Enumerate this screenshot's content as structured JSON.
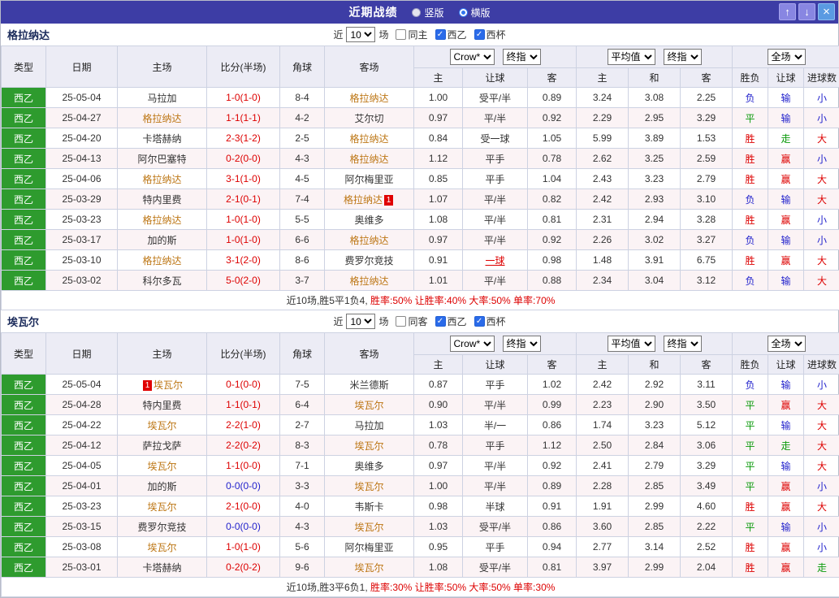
{
  "titlebar": {
    "title": "近期战绩",
    "radio_vertical": "竖版",
    "radio_horizontal": "横版"
  },
  "icons": {
    "up": "↑",
    "down": "↓",
    "close": "×"
  },
  "labels": {
    "near": "近",
    "games": "场"
  },
  "table_head": {
    "type": "类型",
    "date": "日期",
    "home": "主场",
    "score": "比分(半场)",
    "corner": "角球",
    "away": "客场",
    "company": "Crow*",
    "stage": "终指",
    "avg": "平均值",
    "stage2": "终指",
    "scope": "全场",
    "sub": [
      "主",
      "让球",
      "客",
      "主",
      "和",
      "客",
      "胜负",
      "让球",
      "进球数"
    ]
  },
  "colors": {
    "header_bg": "#3d3da5",
    "type_green": "#2e9b2e",
    "team_highlight": "#bd7614",
    "score_red": "#dd0000",
    "score_blue": "#2222cc",
    "result_map": {
      "胜": "#dd0000",
      "平": "#0b9a0b",
      "负": "#2222cc",
      "赢": "#dd0000",
      "走": "#0b9a0b",
      "输": "#2222cc",
      "大": "#dd0000",
      "小": "#2222cc"
    }
  },
  "sections": [
    {
      "team": "格拉纳达",
      "filter": {
        "count": "10",
        "same": "同主",
        "same_checked": false,
        "league": "西乙",
        "league_checked": true,
        "cup": "西杯",
        "cup_checked": true
      },
      "rows": [
        {
          "type": "西乙",
          "date": "25-05-04",
          "home": "马拉加",
          "home_hl": false,
          "score": "1-0(1-0)",
          "corner": "8-4",
          "away": "格拉纳达",
          "away_hl": true,
          "odds_h": "1.00",
          "line": "受平/半",
          "odds_a": "0.89",
          "avg_h": "3.24",
          "avg_d": "3.08",
          "avg_a": "2.25",
          "res": "负",
          "cover": "输",
          "goals": "小"
        },
        {
          "type": "西乙",
          "date": "25-04-27",
          "home": "格拉纳达",
          "home_hl": true,
          "score": "1-1(1-1)",
          "corner": "4-2",
          "away": "艾尔切",
          "away_hl": false,
          "odds_h": "0.97",
          "line": "平/半",
          "odds_a": "0.92",
          "avg_h": "2.29",
          "avg_d": "2.95",
          "avg_a": "3.29",
          "res": "平",
          "cover": "输",
          "goals": "小"
        },
        {
          "type": "西乙",
          "date": "25-04-20",
          "home": "卡塔赫纳",
          "home_hl": false,
          "score": "2-3(1-2)",
          "corner": "2-5",
          "away": "格拉纳达",
          "away_hl": true,
          "odds_h": "0.84",
          "line": "受一球",
          "odds_a": "1.05",
          "avg_h": "5.99",
          "avg_d": "3.89",
          "avg_a": "1.53",
          "res": "胜",
          "cover": "走",
          "goals": "大"
        },
        {
          "type": "西乙",
          "date": "25-04-13",
          "home": "阿尔巴塞特",
          "home_hl": false,
          "score": "0-2(0-0)",
          "corner": "4-3",
          "away": "格拉纳达",
          "away_hl": true,
          "odds_h": "1.12",
          "line": "平手",
          "odds_a": "0.78",
          "avg_h": "2.62",
          "avg_d": "3.25",
          "avg_a": "2.59",
          "res": "胜",
          "cover": "赢",
          "goals": "小"
        },
        {
          "type": "西乙",
          "date": "25-04-06",
          "home": "格拉纳达",
          "home_hl": true,
          "score": "3-1(1-0)",
          "corner": "4-5",
          "away": "阿尔梅里亚",
          "away_hl": false,
          "odds_h": "0.85",
          "line": "平手",
          "odds_a": "1.04",
          "avg_h": "2.43",
          "avg_d": "3.23",
          "avg_a": "2.79",
          "res": "胜",
          "cover": "赢",
          "goals": "大"
        },
        {
          "type": "西乙",
          "date": "25-03-29",
          "home": "特内里费",
          "home_hl": false,
          "score": "2-1(0-1)",
          "corner": "7-4",
          "away": "格拉纳达",
          "away_hl": true,
          "away_badge": "1",
          "away_badge_pos": "after",
          "odds_h": "1.07",
          "line": "平/半",
          "odds_a": "0.82",
          "avg_h": "2.42",
          "avg_d": "2.93",
          "avg_a": "3.10",
          "res": "负",
          "cover": "输",
          "goals": "大"
        },
        {
          "type": "西乙",
          "date": "25-03-23",
          "home": "格拉纳达",
          "home_hl": true,
          "score": "1-0(1-0)",
          "corner": "5-5",
          "away": "奥维多",
          "away_hl": false,
          "odds_h": "1.08",
          "line": "平/半",
          "odds_a": "0.81",
          "avg_h": "2.31",
          "avg_d": "2.94",
          "avg_a": "3.28",
          "res": "胜",
          "cover": "赢",
          "goals": "小"
        },
        {
          "type": "西乙",
          "date": "25-03-17",
          "home": "加的斯",
          "home_hl": false,
          "score": "1-0(1-0)",
          "corner": "6-6",
          "away": "格拉纳达",
          "away_hl": true,
          "odds_h": "0.97",
          "line": "平/半",
          "odds_a": "0.92",
          "avg_h": "2.26",
          "avg_d": "3.02",
          "avg_a": "3.27",
          "res": "负",
          "cover": "输",
          "goals": "小"
        },
        {
          "type": "西乙",
          "date": "25-03-10",
          "home": "格拉纳达",
          "home_hl": true,
          "score": "3-1(2-0)",
          "corner": "8-6",
          "away": "费罗尔竞技",
          "away_hl": false,
          "odds_h": "0.91",
          "line": "一球",
          "line_hl": true,
          "odds_a": "0.98",
          "avg_h": "1.48",
          "avg_d": "3.91",
          "avg_a": "6.75",
          "res": "胜",
          "cover": "赢",
          "goals": "大"
        },
        {
          "type": "西乙",
          "date": "25-03-02",
          "home": "科尔多瓦",
          "home_hl": false,
          "score": "5-0(2-0)",
          "corner": "3-7",
          "away": "格拉纳达",
          "away_hl": true,
          "odds_h": "1.01",
          "line": "平/半",
          "odds_a": "0.88",
          "avg_h": "2.34",
          "avg_d": "3.04",
          "avg_a": "3.12",
          "res": "负",
          "cover": "输",
          "goals": "大"
        }
      ],
      "summary_prefix": "近10场,胜5平1负4,",
      "summary_stats": "胜率:50% 让胜率:40% 大率:50% 单率:70%"
    },
    {
      "team": "埃瓦尔",
      "filter": {
        "count": "10",
        "same": "同客",
        "same_checked": false,
        "league": "西乙",
        "league_checked": true,
        "cup": "西杯",
        "cup_checked": true
      },
      "rows": [
        {
          "type": "西乙",
          "date": "25-05-04",
          "home": "埃瓦尔",
          "home_hl": true,
          "home_badge": "1",
          "home_badge_pos": "before",
          "score": "0-1(0-0)",
          "corner": "7-5",
          "away": "米兰德斯",
          "away_hl": false,
          "odds_h": "0.87",
          "line": "平手",
          "odds_a": "1.02",
          "avg_h": "2.42",
          "avg_d": "2.92",
          "avg_a": "3.11",
          "res": "负",
          "cover": "输",
          "goals": "小"
        },
        {
          "type": "西乙",
          "date": "25-04-28",
          "home": "特内里费",
          "home_hl": false,
          "score": "1-1(0-1)",
          "corner": "6-4",
          "away": "埃瓦尔",
          "away_hl": true,
          "odds_h": "0.90",
          "line": "平/半",
          "odds_a": "0.99",
          "avg_h": "2.23",
          "avg_d": "2.90",
          "avg_a": "3.50",
          "res": "平",
          "cover": "赢",
          "goals": "大"
        },
        {
          "type": "西乙",
          "date": "25-04-22",
          "home": "埃瓦尔",
          "home_hl": true,
          "score": "2-2(1-0)",
          "corner": "2-7",
          "away": "马拉加",
          "away_hl": false,
          "odds_h": "1.03",
          "line": "半/一",
          "odds_a": "0.86",
          "avg_h": "1.74",
          "avg_d": "3.23",
          "avg_a": "5.12",
          "res": "平",
          "cover": "输",
          "goals": "大"
        },
        {
          "type": "西乙",
          "date": "25-04-12",
          "home": "萨拉戈萨",
          "home_hl": false,
          "score": "2-2(0-2)",
          "corner": "8-3",
          "away": "埃瓦尔",
          "away_hl": true,
          "odds_h": "0.78",
          "line": "平手",
          "odds_a": "1.12",
          "avg_h": "2.50",
          "avg_d": "2.84",
          "avg_a": "3.06",
          "res": "平",
          "cover": "走",
          "goals": "大"
        },
        {
          "type": "西乙",
          "date": "25-04-05",
          "home": "埃瓦尔",
          "home_hl": true,
          "score": "1-1(0-0)",
          "corner": "7-1",
          "away": "奥维多",
          "away_hl": false,
          "odds_h": "0.97",
          "line": "平/半",
          "odds_a": "0.92",
          "avg_h": "2.41",
          "avg_d": "2.79",
          "avg_a": "3.29",
          "res": "平",
          "cover": "输",
          "goals": "大"
        },
        {
          "type": "西乙",
          "date": "25-04-01",
          "home": "加的斯",
          "home_hl": false,
          "score": "0-0(0-0)",
          "score_blue": true,
          "corner": "3-3",
          "away": "埃瓦尔",
          "away_hl": true,
          "odds_h": "1.00",
          "line": "平/半",
          "odds_a": "0.89",
          "avg_h": "2.28",
          "avg_d": "2.85",
          "avg_a": "3.49",
          "res": "平",
          "cover": "赢",
          "goals": "小"
        },
        {
          "type": "西乙",
          "date": "25-03-23",
          "home": "埃瓦尔",
          "home_hl": true,
          "score": "2-1(0-0)",
          "corner": "4-0",
          "away": "韦斯卡",
          "away_hl": false,
          "odds_h": "0.98",
          "line": "半球",
          "odds_a": "0.91",
          "avg_h": "1.91",
          "avg_d": "2.99",
          "avg_a": "4.60",
          "res": "胜",
          "cover": "赢",
          "goals": "大"
        },
        {
          "type": "西乙",
          "date": "25-03-15",
          "home": "费罗尔竞技",
          "home_hl": false,
          "score": "0-0(0-0)",
          "score_blue": true,
          "corner": "4-3",
          "away": "埃瓦尔",
          "away_hl": true,
          "odds_h": "1.03",
          "line": "受平/半",
          "odds_a": "0.86",
          "avg_h": "3.60",
          "avg_d": "2.85",
          "avg_a": "2.22",
          "res": "平",
          "cover": "输",
          "goals": "小"
        },
        {
          "type": "西乙",
          "date": "25-03-08",
          "home": "埃瓦尔",
          "home_hl": true,
          "score": "1-0(1-0)",
          "corner": "5-6",
          "away": "阿尔梅里亚",
          "away_hl": false,
          "odds_h": "0.95",
          "line": "平手",
          "odds_a": "0.94",
          "avg_h": "2.77",
          "avg_d": "3.14",
          "avg_a": "2.52",
          "res": "胜",
          "cover": "赢",
          "goals": "小"
        },
        {
          "type": "西乙",
          "date": "25-03-01",
          "home": "卡塔赫纳",
          "home_hl": false,
          "score": "0-2(0-2)",
          "corner": "9-6",
          "away": "埃瓦尔",
          "away_hl": true,
          "odds_h": "1.08",
          "line": "受平/半",
          "odds_a": "0.81",
          "avg_h": "3.97",
          "avg_d": "2.99",
          "avg_a": "2.04",
          "res": "胜",
          "cover": "赢",
          "goals": "走"
        }
      ],
      "summary_prefix": "近10场,胜3平6负1,",
      "summary_stats": "胜率:30% 让胜率:50% 大率:50% 单率:30%"
    }
  ]
}
